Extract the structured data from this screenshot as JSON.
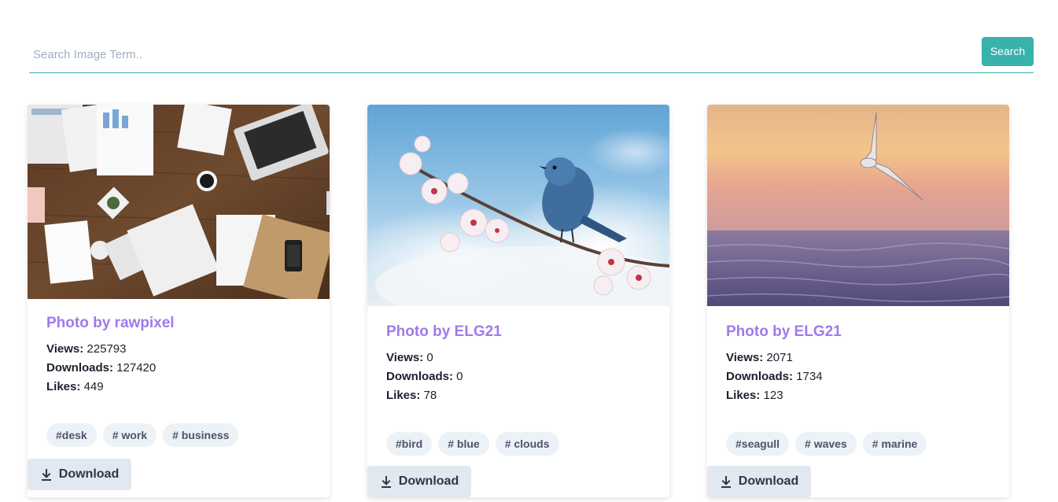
{
  "search": {
    "placeholder": "Search Image Term..",
    "button_label": "Search"
  },
  "cards": [
    {
      "title": "Photo by rawpixel",
      "views_label": "Views:",
      "views": "225793",
      "downloads_label": "Downloads:",
      "downloads": "127420",
      "likes_label": "Likes:",
      "likes": "449",
      "tags": [
        "#desk",
        "# work",
        "# business"
      ],
      "download_label": "Download",
      "image_alt": "office desk flat lay"
    },
    {
      "title": "Photo by ELG21",
      "views_label": "Views:",
      "views": "0",
      "downloads_label": "Downloads:",
      "downloads": "0",
      "likes_label": "Likes:",
      "likes": "78",
      "tags": [
        "#bird",
        "# blue",
        "# clouds"
      ],
      "download_label": "Download",
      "image_alt": "blue bird on cherry blossom branch"
    },
    {
      "title": "Photo by ELG21",
      "views_label": "Views:",
      "views": "2071",
      "downloads_label": "Downloads:",
      "downloads": "1734",
      "likes_label": "Likes:",
      "likes": "123",
      "tags": [
        "#seagull",
        "# waves",
        "# marine"
      ],
      "download_label": "Download",
      "image_alt": "seagull over sunset sea"
    }
  ],
  "colors": {
    "accent": "#38b2ac",
    "title": "#9f7aea",
    "tag_bg": "#edf2f7",
    "button_bg": "#e2e8f0"
  }
}
